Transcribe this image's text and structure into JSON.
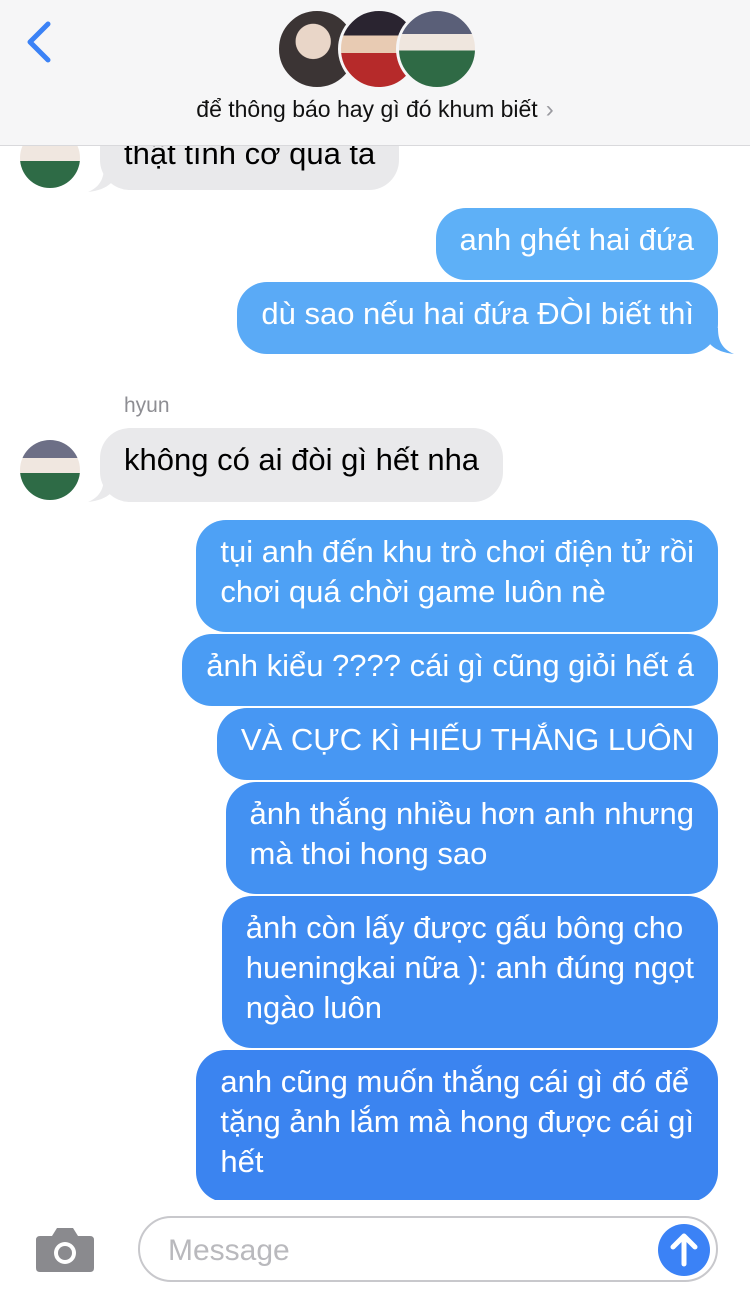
{
  "header": {
    "back_icon": "chevron-left-icon",
    "group_name": "để thông báo hay gì đó khum biết",
    "chevron": "›"
  },
  "colors": {
    "accent": "#3b82f6",
    "incoming_bubble": "#e9e9eb",
    "header_bg": "#f6f6f7"
  },
  "messages": [
    {
      "dir": "in",
      "text": "thật tình cờ quá ta"
    },
    {
      "dir": "out",
      "text": "anh ghét hai đứa"
    },
    {
      "dir": "out",
      "text": "dù sao nếu hai đứa ĐÒI biết thì"
    },
    {
      "dir": "in",
      "sender": "hyun",
      "text": "không có ai đòi gì hết nha"
    },
    {
      "dir": "out",
      "lines": [
        "tụi anh đến khu trò chơi điện tử rồi",
        "chơi quá chời game luôn nè"
      ]
    },
    {
      "dir": "out",
      "text": "ảnh kiểu ???? cái gì cũng giỏi hết á"
    },
    {
      "dir": "out",
      "text": "VÀ CỰC KÌ HIẾU THẮNG LUÔN"
    },
    {
      "dir": "out",
      "lines": [
        "ảnh thắng nhiều hơn anh nhưng",
        "mà thoi hong sao"
      ]
    },
    {
      "dir": "out",
      "lines": [
        "ảnh còn lấy được gấu bông cho",
        "hueningkai nữa ): anh đúng ngọt",
        "ngào luôn"
      ]
    },
    {
      "dir": "out",
      "lines": [
        "anh cũng muốn thắng cái gì đó để",
        "tặng ảnh lắm mà hong được cái gì",
        "hết"
      ]
    }
  ],
  "input": {
    "placeholder": "Message",
    "camera_icon": "camera-icon",
    "send_icon": "arrow-up-icon"
  }
}
